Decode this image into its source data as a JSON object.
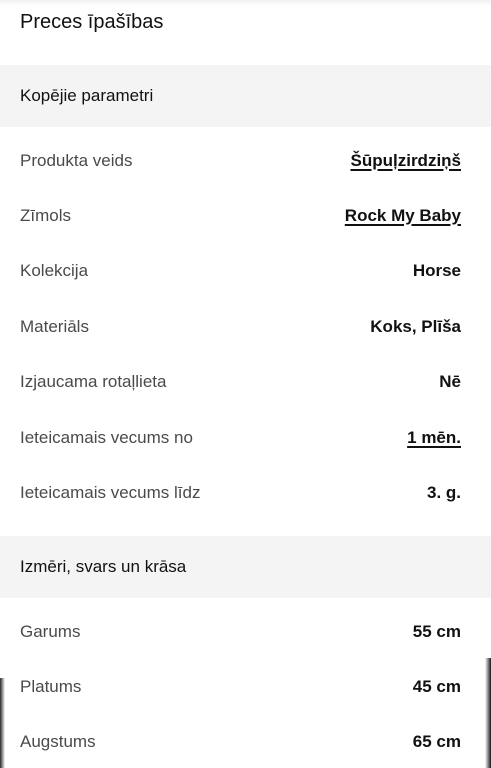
{
  "page": {
    "title": "Preces īpašības"
  },
  "sections": [
    {
      "title": "Kopējie parametri",
      "rows": [
        {
          "label": "Produkta veids",
          "value": "Šūpuļzirdziņš",
          "link": true
        },
        {
          "label": "Zīmols",
          "value": "Rock My Baby",
          "link": true
        },
        {
          "label": "Kolekcija",
          "value": "Horse",
          "link": false
        },
        {
          "label": "Materiāls",
          "value": "Koks, Plīša",
          "link": false
        },
        {
          "label": "Izjaucama rotaļlieta",
          "value": "Nē",
          "link": false
        },
        {
          "label": "Ieteicamais vecums no",
          "value": "1 mēn.",
          "link": true
        },
        {
          "label": "Ieteicamais vecums līdz",
          "value": "3. g.",
          "link": false
        }
      ]
    },
    {
      "title": "Izmēri, svars un krāsa",
      "rows": [
        {
          "label": "Garums",
          "value": "55 cm",
          "link": false
        },
        {
          "label": "Platums",
          "value": "45 cm",
          "link": false
        },
        {
          "label": "Augstums",
          "value": "65 cm",
          "link": false
        }
      ]
    }
  ],
  "colors": {
    "section_background": "#f4f4f4",
    "label_text": "#4a4a4a",
    "value_text": "#111111"
  }
}
